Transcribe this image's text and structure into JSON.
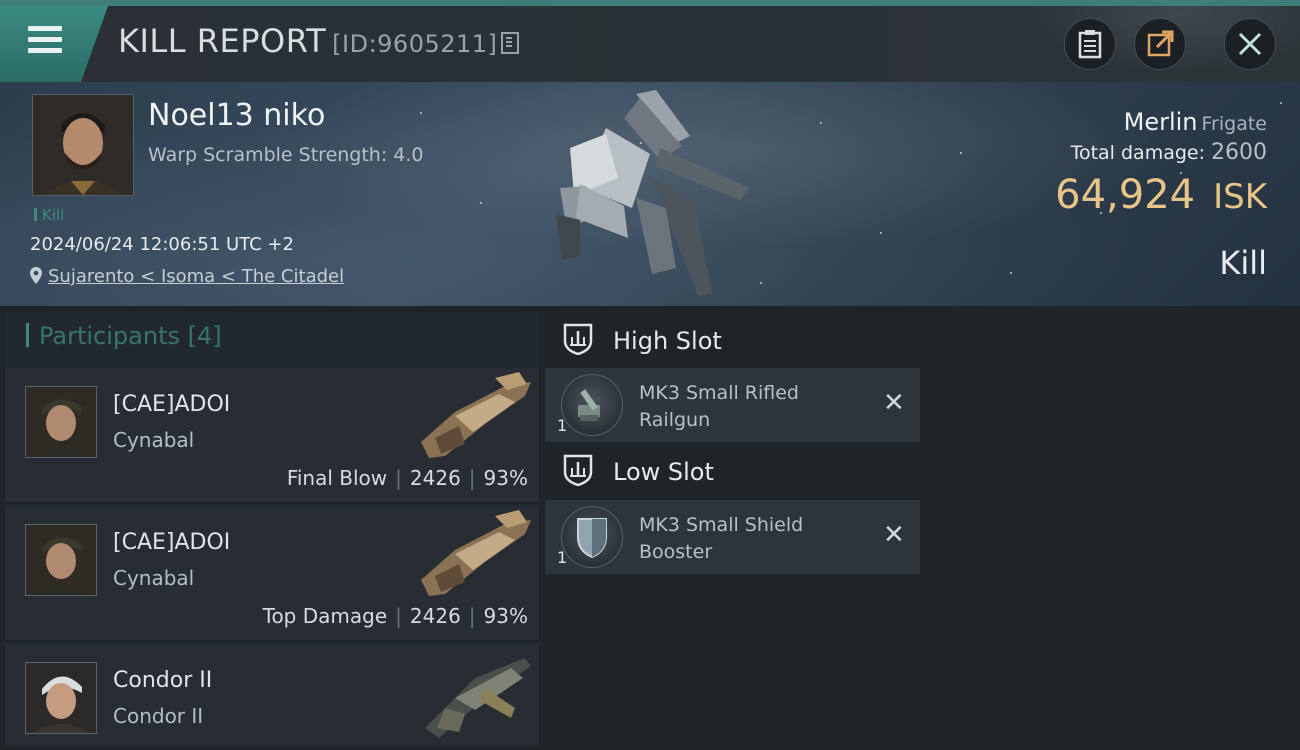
{
  "header": {
    "title": "KILL REPORT",
    "report_id": "[ID:9605211]",
    "icons": {
      "menu": "hamburger-menu-icon",
      "copy": "copy-icon",
      "clipboard": "clipboard-icon",
      "share": "share-icon",
      "close": "close-icon"
    }
  },
  "victim": {
    "name": "Noel13 niko",
    "warp_scramble": "Warp Scramble Strength: 4.0",
    "tag": "Kill",
    "datetime": "2024/06/24 12:06:51 UTC +2",
    "location": "Sujarento < Isoma < The Citadel",
    "ship_name": "Merlin",
    "ship_class": "Frigate",
    "total_damage_label": "Total damage:",
    "total_damage": "2600",
    "isk_value": "64,924",
    "isk_unit": "ISK",
    "result": "Kill"
  },
  "participants": {
    "label": "Participants",
    "count": "[4]",
    "items": [
      {
        "name": "[CAE]ADOI",
        "ship": "Cynabal",
        "role": "Final Blow",
        "damage": "2426",
        "percent": "93%"
      },
      {
        "name": "[CAE]ADOI",
        "ship": "Cynabal",
        "role": "Top Damage",
        "damage": "2426",
        "percent": "93%"
      },
      {
        "name": "Condor II",
        "ship": "Condor II",
        "role": "",
        "damage": "",
        "percent": ""
      }
    ]
  },
  "slots": {
    "high": {
      "title": "High Slot",
      "items": [
        {
          "qty": "1",
          "name_line1": "MK3 Small Rifled",
          "name_line2": "Railgun"
        }
      ]
    },
    "low": {
      "title": "Low Slot",
      "items": [
        {
          "qty": "1",
          "name_line1": "MK3 Small Shield",
          "name_line2": "Booster"
        }
      ]
    }
  },
  "colors": {
    "accent": "#3f8a80",
    "isk": "#e8c488"
  }
}
